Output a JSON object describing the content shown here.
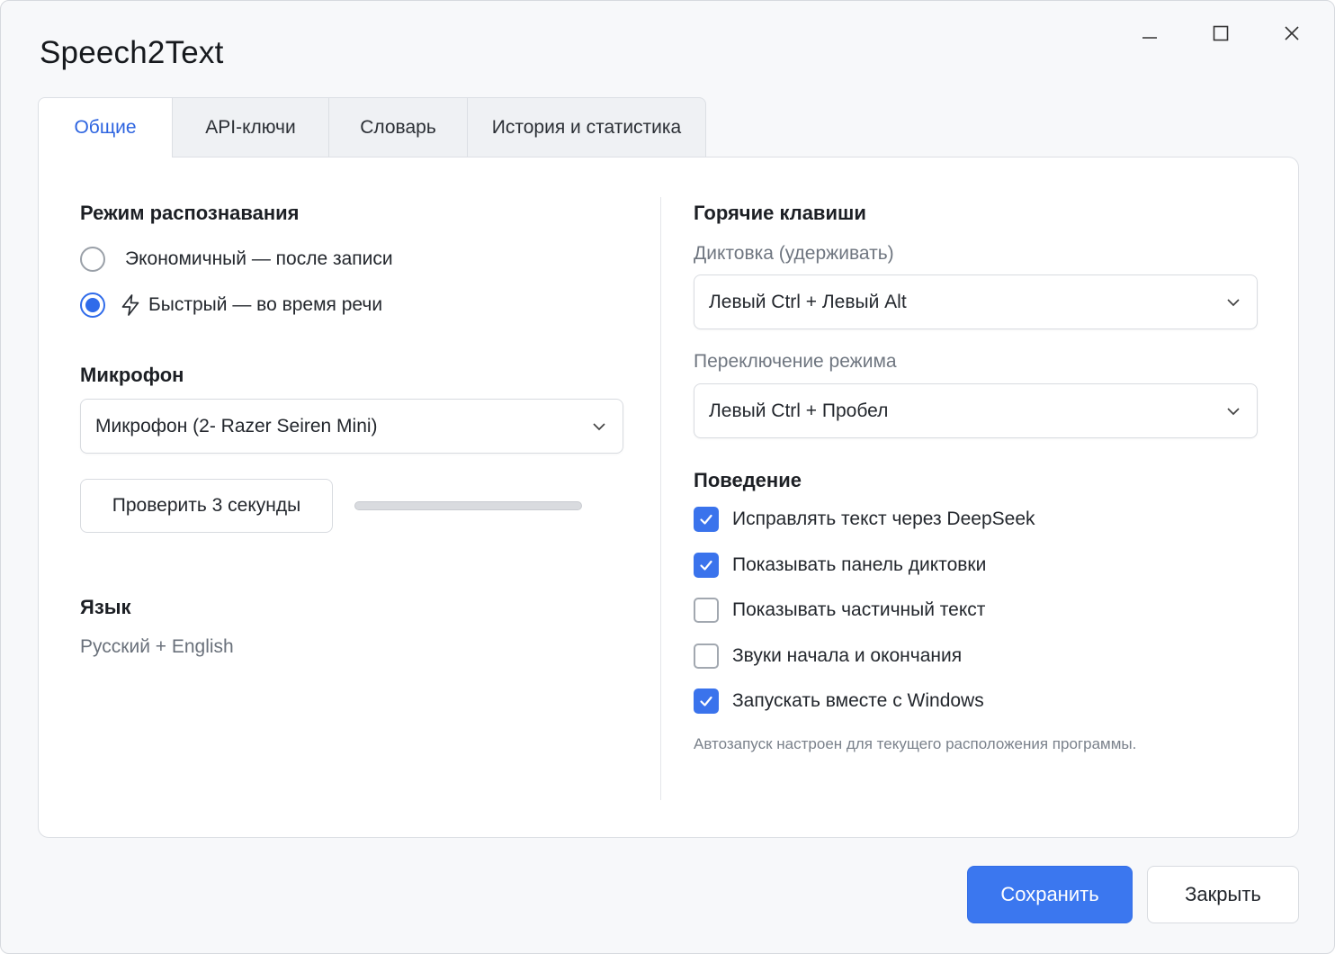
{
  "window": {
    "title": "Speech2Text",
    "controls": [
      "minimize-icon",
      "maximize-icon",
      "close-icon"
    ]
  },
  "tabs": [
    {
      "label": "Общие",
      "active": true
    },
    {
      "label": "API-ключи",
      "active": false
    },
    {
      "label": "Словарь",
      "active": false
    },
    {
      "label": "История и статистика",
      "active": false
    }
  ],
  "recognition": {
    "title": "Режим распознавания",
    "options": [
      {
        "label": "Экономичный — после записи",
        "selected": false
      },
      {
        "label": "Быстрый — во время речи",
        "selected": true,
        "icon": "lightning-icon"
      }
    ]
  },
  "microphone": {
    "title": "Микрофон",
    "selected": "Микрофон (2- Razer Seiren Mini)",
    "test_button": "Проверить 3 секунды",
    "level": 0
  },
  "language": {
    "title": "Язык",
    "value": "Русский + English"
  },
  "hotkeys": {
    "title": "Горячие клавиши",
    "dictation_label": "Диктовка (удерживать)",
    "dictation_value": "Левый Ctrl + Левый Alt",
    "mode_switch_label": "Переключение режима",
    "mode_switch_value": "Левый Ctrl + Пробел"
  },
  "behavior": {
    "title": "Поведение",
    "options": [
      {
        "label": "Исправлять текст через DeepSeek",
        "checked": true
      },
      {
        "label": "Показывать панель диктовки",
        "checked": true
      },
      {
        "label": "Показывать частичный текст",
        "checked": false
      },
      {
        "label": "Звуки начала и окончания",
        "checked": false
      },
      {
        "label": "Запускать вместе с Windows",
        "checked": true
      }
    ],
    "note": "Автозапуск настроен для текущего расположения программы."
  },
  "footer": {
    "save": "Сохранить",
    "close": "Закрыть"
  },
  "colors": {
    "accent": "#3b77ef",
    "active_tab_text": "#2d64e0"
  }
}
